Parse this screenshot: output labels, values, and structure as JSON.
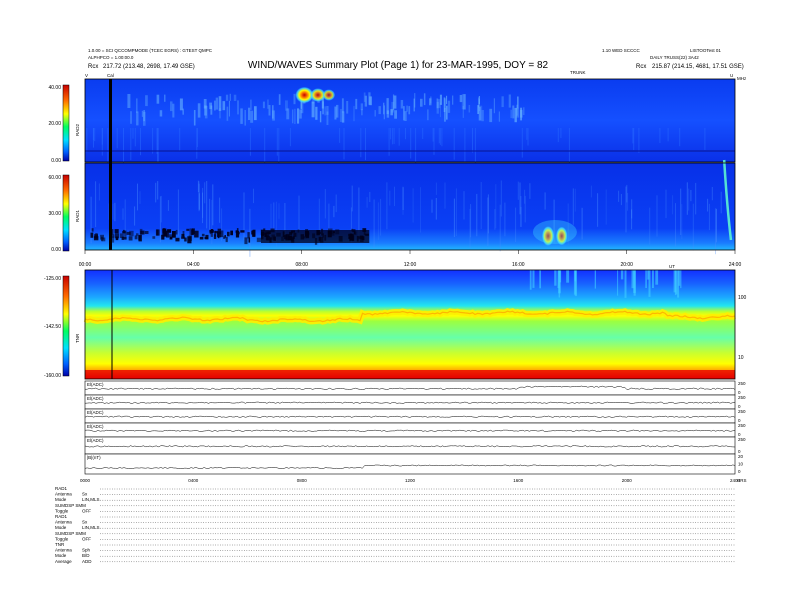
{
  "header": {
    "left_line1": "1.0.00 = SCI QCCOMPMODE (TCEC EGRS) : GTEST QMPC",
    "left_line2": "ALPHPCO = 1.00:00.0",
    "left_pos": "217.72 (213.48, 2698, 17.49 GSE)",
    "title": "WIND/WAVES Summary Plot (Page 1) for 23-MAR-1995, DOY = 82",
    "right_line1": "1.10 WED SCCCC",
    "right_line1b": "LISTOOTest 01",
    "right_line2": "DAILY TRUSS(22) 3A42",
    "right_pos": "215.87 (214.15, 4681, 17.51 GSE)",
    "rpos_label": "Rcx",
    "mark_top_left": "V",
    "mark_top_right": "U",
    "cal_label": "Cal",
    "trunk_label": "TRUNK",
    "mhz_label": "MHz",
    "ut_label": "UT",
    "hrs_label": "HRS"
  },
  "chart_data": [
    {
      "type": "heatmap",
      "panel": "RAD2",
      "colorbar_ticks": [
        "40.00",
        "20.00",
        "0.00"
      ],
      "zlim": [
        0,
        40
      ],
      "xlim": [
        0,
        24
      ],
      "bursts": [
        {
          "t": 8.1,
          "intensity": 40
        },
        {
          "t": 8.6,
          "intensity": 30
        },
        {
          "t": 9.0,
          "intensity": 22
        }
      ]
    },
    {
      "type": "heatmap",
      "panel": "RAD1",
      "colorbar_ticks": [
        "60.00",
        "30.00",
        "0.00"
      ],
      "zlim": [
        0,
        60
      ],
      "xlim": [
        0,
        24
      ],
      "x_tick_labels": [
        "00:00",
        "04:00",
        "08:00",
        "12:00",
        "16:00",
        "20:00",
        "24:00"
      ],
      "bursts": [
        {
          "t": 17.1,
          "intensity": 55
        },
        {
          "t": 17.6,
          "intensity": 50
        }
      ]
    },
    {
      "type": "heatmap",
      "panel": "TNR",
      "colorbar_ticks": [
        "-125.00",
        "-142.50",
        "-160.00"
      ],
      "zlim": [
        -160,
        -125
      ],
      "xlim": [
        0,
        24
      ],
      "right_axis_ticks": [
        "100",
        "10"
      ]
    },
    {
      "type": "line",
      "panel": "lines",
      "xlim": [
        0,
        24
      ],
      "x_tick_labels": [
        "0000",
        "0400",
        "0800",
        "1200",
        "1600",
        "2000",
        "2400"
      ],
      "series": [
        {
          "name": "El(ADC)",
          "right_ticks": [
            "250",
            "0"
          ]
        },
        {
          "name": "El(ADC)",
          "right_ticks": [
            "250",
            "0"
          ]
        },
        {
          "name": "El(ADC)",
          "right_ticks": [
            "250",
            "0"
          ]
        },
        {
          "name": "El(ADC)",
          "right_ticks": [
            "250",
            "0"
          ]
        },
        {
          "name": "El(ADC)",
          "right_ticks": [
            "250",
            "0"
          ]
        },
        {
          "name": "|B|(nT)",
          "right_ticks": [
            "20",
            "10",
            "0"
          ]
        }
      ]
    }
  ],
  "panel_labels": {
    "rad2": "RAD2",
    "rad1": "RAD1",
    "tnr": "TNR"
  },
  "instrument_settings": [
    {
      "k": "RAD1",
      "v": ""
    },
    {
      "k": "Antenna",
      "v": "Sx"
    },
    {
      "k": "Mode",
      "v": "LIN,MLS"
    },
    {
      "k": "SUMDSP SMM",
      "v": ""
    },
    {
      "k": "Toggle",
      "v": "OFF"
    },
    {
      "k": "RAD1",
      "v": ""
    },
    {
      "k": "Antenna",
      "v": "Sx"
    },
    {
      "k": "Mode",
      "v": "LIN,MLS"
    },
    {
      "k": "SUMDSP SMM",
      "v": ""
    },
    {
      "k": "Toggle",
      "v": "OFF"
    },
    {
      "k": "TNR",
      "v": ""
    },
    {
      "k": "Antenna",
      "v": "Sph"
    },
    {
      "k": "Mode",
      "v": "B/D"
    },
    {
      "k": "Average",
      "v": "ADD"
    }
  ],
  "colors": {
    "background": "#0022ee",
    "colorbar_top": "#cc0000",
    "colorbar_bottom": "#0000aa"
  }
}
